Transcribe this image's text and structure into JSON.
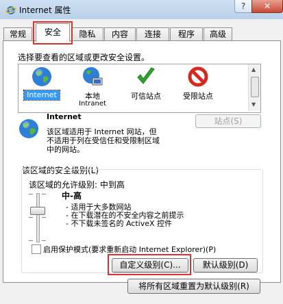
{
  "window": {
    "title": "Internet 属性",
    "help_label": "?",
    "close_label": "✕"
  },
  "tabs": [
    "常规",
    "安全",
    "隐私",
    "内容",
    "连接",
    "程序",
    "高级"
  ],
  "security": {
    "instruction": "选择要查看的区域或更改安全设置。",
    "zones": [
      {
        "name": "Internet",
        "sub": ""
      },
      {
        "name": "本地",
        "sub": "Intranet"
      },
      {
        "name": "可信站点",
        "sub": ""
      },
      {
        "name": "受限站点",
        "sub": ""
      }
    ],
    "selected_zone_title": "Internet",
    "zone_desc": [
      "该区域适用于 Internet 网站，但",
      "不适用于列在受信任和受限制区域",
      "中的网站。"
    ],
    "sites_button": "站点(S)",
    "level_group_title": "该区域的安全级别(L)",
    "allowed_levels": "该区域的允许级别: 中到高",
    "level_name": "中-高",
    "level_bullets": [
      "- 适用于大多数网站",
      "- 在下载潜在的不安全内容之前提示",
      "- 不下载未签名的 ActiveX 控件"
    ],
    "protected_mode_label": "启用保护模式(要求重新启动 Internet Explorer)(P)",
    "protected_mode_checked": false,
    "custom_level_button": "自定义级别(C)...",
    "default_level_button": "默认级别(D)",
    "reset_all_button": "将所有区域重置为默认级别(R)",
    "slider_level_fraction": 0.67
  },
  "colors": {
    "highlight": "#e0302e",
    "selected_bg": "#3399ff"
  }
}
